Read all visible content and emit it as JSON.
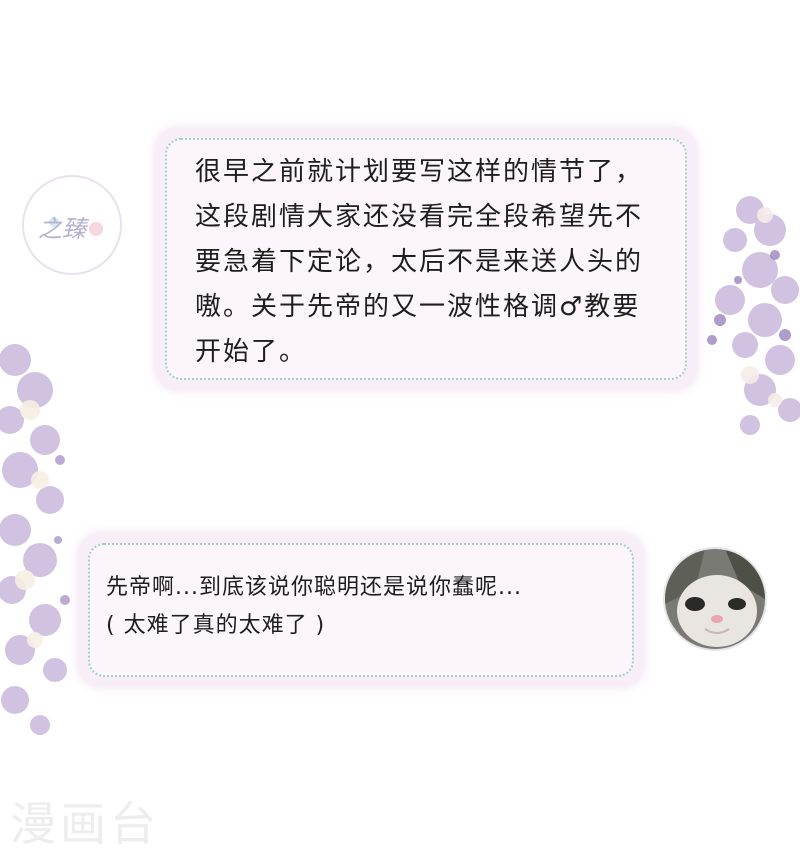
{
  "author_comment": {
    "avatar_icon": "author-seal-logo",
    "avatar_text": "之臻",
    "text": "很早之前就计划要写这样的情节了，\n这段剧情大家还没看完全段希望先不\n要急着下定论，太后不是来送人头的\n嗷。关于先帝的又一波性格调♂教要\n开始了。"
  },
  "reader_comment": {
    "avatar_icon": "cat-avatar",
    "text": "先帝啊...到底该说你聪明还是说你蠢呢...\n( 太难了真的太难了 )"
  },
  "watermark": "漫画台",
  "colors": {
    "bubble_fill": "#fdf5fc",
    "bubble_border": "#9fd0cf",
    "blossom": "#b7a2cf"
  }
}
